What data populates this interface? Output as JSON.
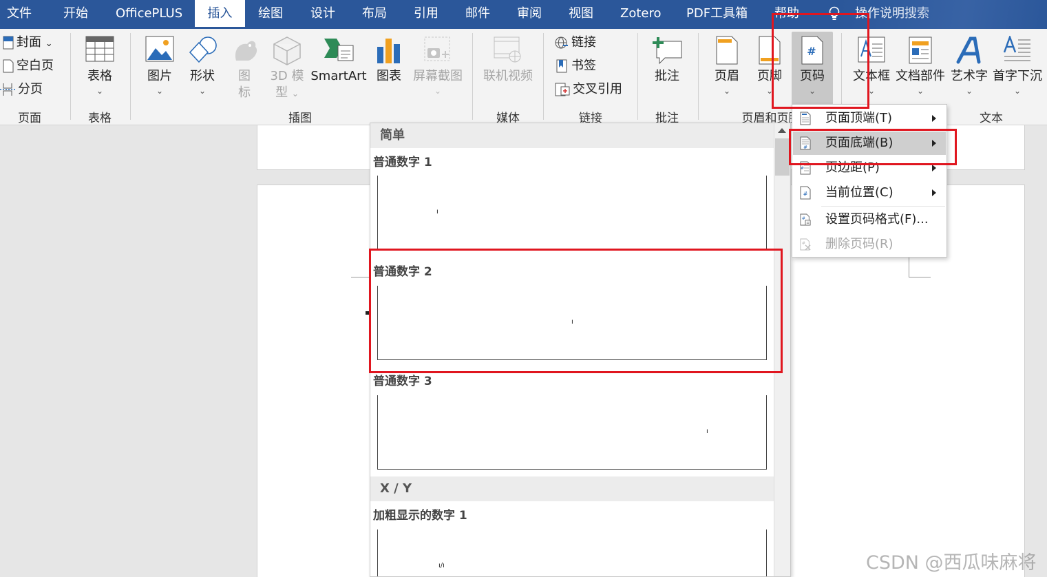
{
  "menu_tabs": [
    "文件",
    "开始",
    "OfficePLUS",
    "插入",
    "绘图",
    "设计",
    "布局",
    "引用",
    "邮件",
    "审阅",
    "视图",
    "Zotero",
    "PDF工具箱",
    "帮助",
    "操作说明搜索"
  ],
  "active_tab": "插入",
  "ribbon": {
    "pages_group": {
      "label": "页面",
      "cover": "封面",
      "cover_chevron": "⌄",
      "blank": "空白页",
      "break": "分页"
    },
    "table_group": {
      "label": "表格",
      "table": "表格"
    },
    "illustrations_group": {
      "label": "插图",
      "picture": "图片",
      "shapes": "形状",
      "icons_1": "图",
      "icons_2": "标",
      "model_1": "3D 模",
      "model_2": "型",
      "smartart": "SmartArt",
      "chart": "图表",
      "screenshot": "屏幕截图"
    },
    "media_group": {
      "label": "媒体",
      "online_video": "联机视频"
    },
    "links_group": {
      "label": "链接",
      "link": "链接",
      "bookmark": "书签",
      "cross_ref": "交叉引用"
    },
    "comments_group": {
      "label": "批注",
      "comment": "批注"
    },
    "header_footer_group": {
      "label": "页眉和页脚",
      "header": "页眉",
      "footer": "页脚",
      "page_number": "页码"
    },
    "text_group": {
      "label": "文本",
      "textbox": "文本框",
      "quick_parts": "文档部件",
      "wordart": "艺术字",
      "dropcap": "首字下沉"
    },
    "chevron": "⌄"
  },
  "gallery": {
    "sections": [
      {
        "heading": "简单",
        "items": [
          "普通数字 1",
          "普通数字 2",
          "普通数字 3"
        ]
      },
      {
        "heading": "X / Y",
        "items": [
          "加粗显示的数字 1"
        ]
      }
    ],
    "thumb_marks": [
      "ı",
      "ı",
      "ı",
      "ı/ı"
    ]
  },
  "page_number_menu": {
    "items": [
      {
        "label": "页面顶端(T)",
        "submenu": true,
        "state": "normal"
      },
      {
        "label": "页面底端(B)",
        "submenu": true,
        "state": "hover"
      },
      {
        "label": "页边距(P)",
        "submenu": true,
        "state": "normal"
      },
      {
        "label": "当前位置(C)",
        "submenu": true,
        "state": "normal"
      },
      {
        "label": "设置页码格式(F)...",
        "submenu": false,
        "state": "normal"
      },
      {
        "label": "删除页码(R)",
        "submenu": false,
        "state": "disabled"
      }
    ]
  },
  "icon_glyphs": {
    "page_number_hash": "#"
  },
  "watermark": "CSDN @西瓜味麻将",
  "colors": {
    "title_bar": "#2b579a",
    "highlight_red": "#e0161f",
    "ribbon_bg": "#f3f3f3",
    "menu_hover": "#cfcfcf"
  }
}
